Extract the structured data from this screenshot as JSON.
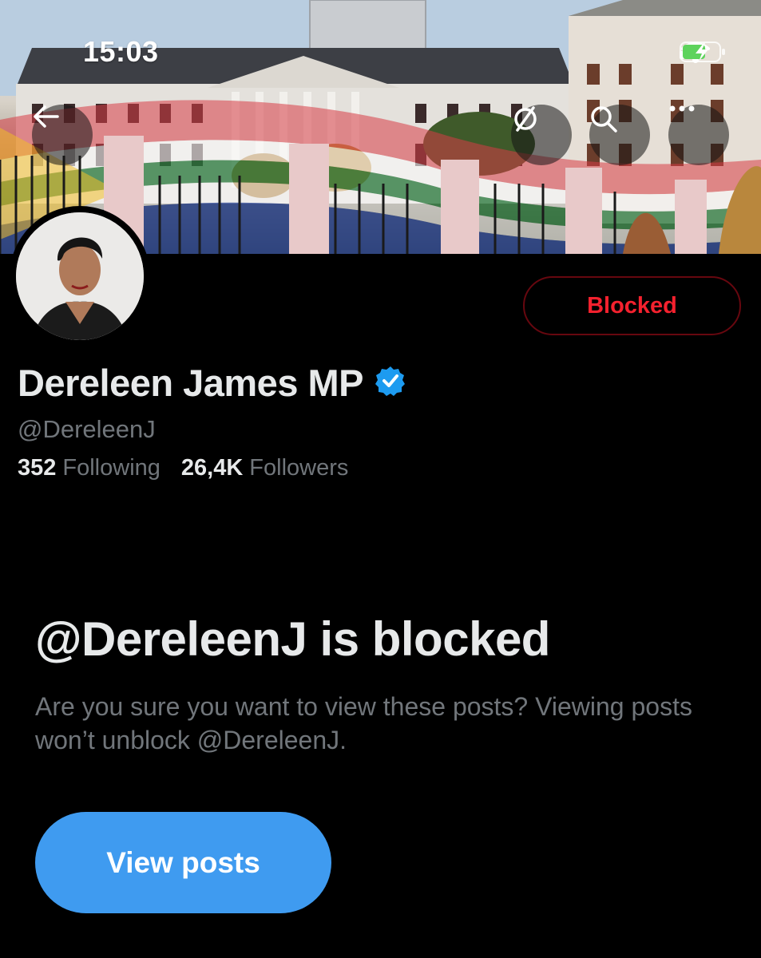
{
  "status_bar": {
    "time": "15:03",
    "icons": [
      "signal-icon",
      "wifi-icon",
      "battery-charging-icon"
    ]
  },
  "header": {
    "back_icon": "arrow-left-icon",
    "grok_icon": "slash-circle-icon",
    "search_icon": "search-icon",
    "more_icon": "more-horizontal-icon"
  },
  "profile": {
    "display_name": "Dereleen James MP",
    "verified_icon": "verified-badge-icon",
    "handle": "@DereleenJ",
    "following_count": "352",
    "following_label": "Following",
    "followers_count": "26,4K",
    "followers_label": "Followers",
    "blocked_button_label": "Blocked"
  },
  "blocked_notice": {
    "title": "@DereleenJ is blocked",
    "description": "Are you sure you want to view these posts? Viewing posts won’t unblock @DereleenJ.",
    "view_button_label": "View posts"
  },
  "colors": {
    "background": "#000000",
    "blocked_red": "#f4212e",
    "accent_blue": "#3f9bf0",
    "verified_blue": "#1d9bf0",
    "secondary_text": "#71767b"
  }
}
